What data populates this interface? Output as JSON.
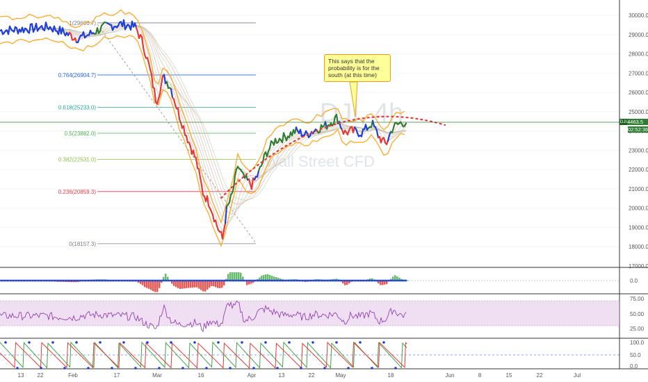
{
  "watermark": {
    "symbol": "DJI, 4h",
    "name": "Wall Street CFD"
  },
  "annotation": {
    "text": "This says that the probability is for the south (at this time)"
  },
  "price_axis": {
    "labels": [
      "30000.0",
      "29000.0",
      "28000.0",
      "27000.0",
      "26000.0",
      "25000.0",
      "24000.0",
      "23000.0",
      "22000.0",
      "21000.0",
      "20000.0",
      "19000.0",
      "18000.0",
      "17000.0"
    ],
    "current_symbol": "DJI",
    "current_price": "24463.5",
    "countdown": "02:52:36"
  },
  "fib_levels": [
    {
      "label": "1(29606.7)",
      "value": 29606.7,
      "color": "#787b86"
    },
    {
      "label": "0.764(26904.7)",
      "value": 26904.7,
      "color": "#2962ff"
    },
    {
      "label": "0.618(25233.0)",
      "value": 25233.0,
      "color": "#26a69a"
    },
    {
      "label": "0.5(23882.0)",
      "value": 23882.0,
      "color": "#4caf50"
    },
    {
      "label": "0.382(22531.0)",
      "value": 22531.0,
      "color": "#8bc34a"
    },
    {
      "label": "0.236(20859.3)",
      "value": 20859.3,
      "color": "#f23645"
    },
    {
      "label": "0(18157.3)",
      "value": 18157.3,
      "color": "#787b86"
    }
  ],
  "osc1": {
    "labels": [
      "0.0"
    ]
  },
  "osc2": {
    "labels": [
      "75.00",
      "50.00",
      "25.00"
    ]
  },
  "osc3": {
    "labels": [
      "100.0",
      "50.0",
      "0.0"
    ]
  },
  "time_axis": {
    "labels": [
      "13",
      "22",
      "Feb",
      "17",
      "Mar",
      "16",
      "Apr",
      "13",
      "22",
      "May",
      "18",
      "Jun",
      "8",
      "15",
      "22",
      "Jul"
    ]
  },
  "colors": {
    "up": "#2e7d32",
    "down": "#e53935",
    "neutral": "#1e3fd6",
    "channel": "#ffa726",
    "projection": "#e53935"
  }
}
